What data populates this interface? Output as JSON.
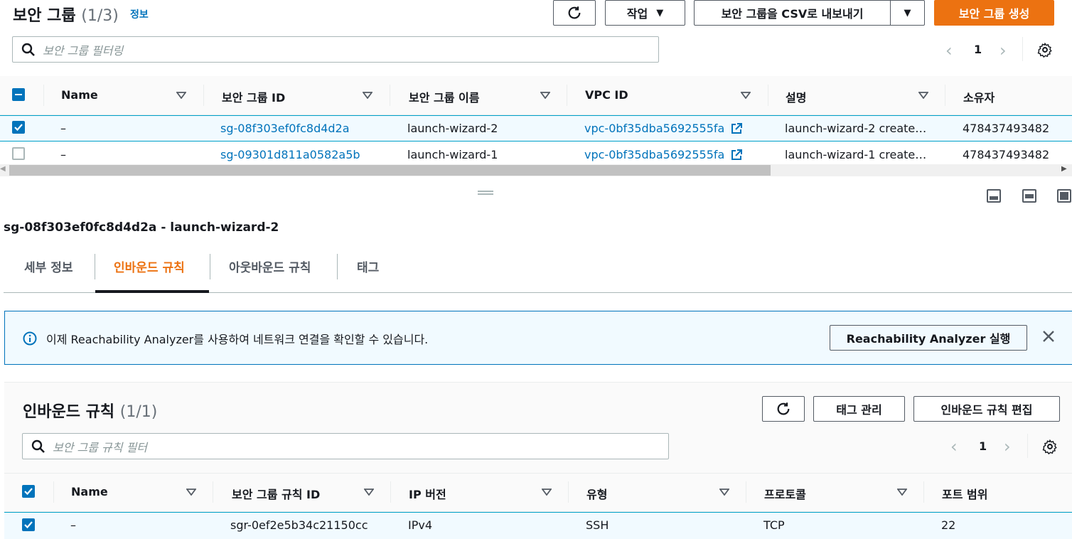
{
  "header": {
    "title": "보안 그룹",
    "count": "(1/3)",
    "info_link": "정보",
    "refresh_label": "",
    "actions_label": "작업",
    "export_label": "보안 그룹을 CSV로 내보내기",
    "create_label": "보안 그룹 생성"
  },
  "sg_search": {
    "placeholder": "보안 그룹 필터링"
  },
  "sg_pager": {
    "page": "1"
  },
  "sg_table": {
    "columns": [
      "Name",
      "보안 그룹 ID",
      "보안 그룹 이름",
      "VPC ID",
      "설명",
      "소유자"
    ],
    "rows": [
      {
        "name": "–",
        "id": "sg-08f303ef0fc8d4d2a",
        "group_name": "launch-wizard-2",
        "vpc": "vpc-0bf35dba5692555fa",
        "desc": "launch-wizard-2 create…",
        "owner": "478437493482",
        "checked": true
      },
      {
        "name": "–",
        "id": "sg-09301d811a0582a5b",
        "group_name": "launch-wizard-1",
        "vpc": "vpc-0bf35dba5692555fa",
        "desc": "launch-wizard-1 create…",
        "owner": "478437493482",
        "checked": false
      }
    ]
  },
  "detail": {
    "title": "sg-08f303ef0fc8d4d2a - launch-wizard-2",
    "tabs": [
      "세부 정보",
      "인바운드 규칙",
      "아웃바운드 규칙",
      "태그"
    ],
    "active_tab": "인바운드 규칙"
  },
  "alert": {
    "text": "이제 Reachability Analyzer를 사용하여 네트워크 연결을 확인할 수 있습니다.",
    "button": "Reachability Analyzer 실행"
  },
  "inbound": {
    "title": "인바운드 규칙",
    "count": "(1/1)",
    "manage_tags": "태그 관리",
    "edit_rules": "인바운드 규칙 편집",
    "search_placeholder": "보안 그룹 규칙 필터",
    "page": "1",
    "columns": [
      "Name",
      "보안 그룹 규칙 ID",
      "IP 버전",
      "유형",
      "프로토콜",
      "포트 범위"
    ],
    "rows": [
      {
        "name": "–",
        "id": "sgr-0ef2e5b34c21150cc",
        "ip": "IPv4",
        "type": "SSH",
        "protocol": "TCP",
        "port": "22",
        "checked": true
      }
    ]
  },
  "colors": {
    "accent": "#ec7211",
    "link": "#0073bb",
    "selected_bg": "#f1faff",
    "info_bg": "#f1faff"
  }
}
